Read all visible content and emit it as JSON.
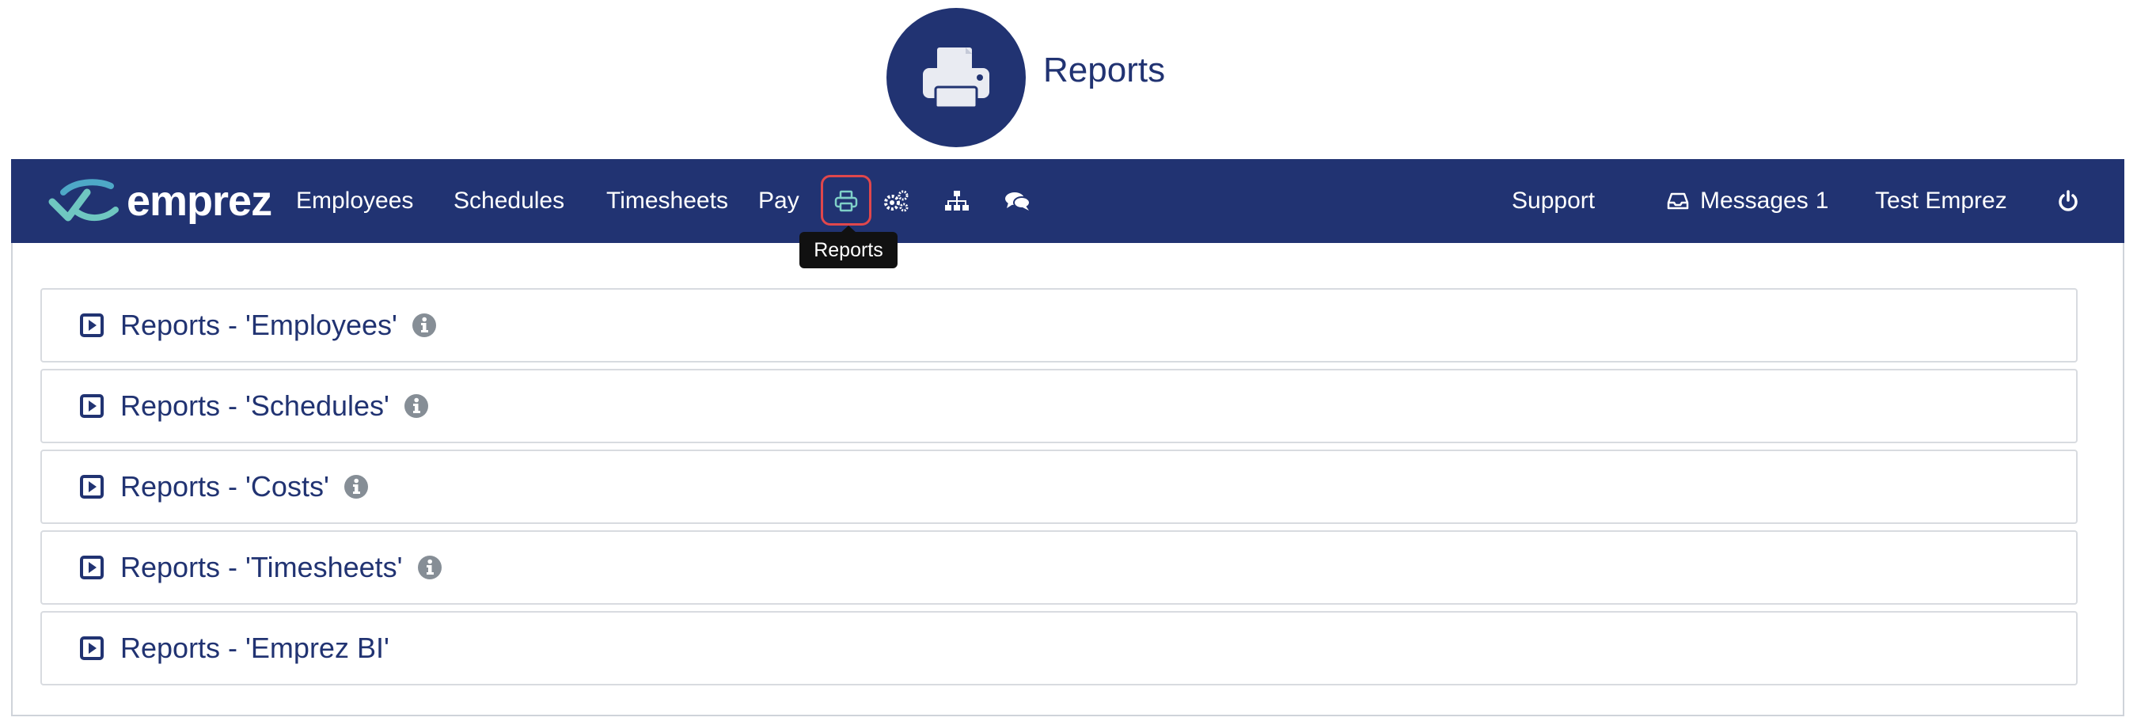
{
  "header": {
    "title": "Reports",
    "icon": "printer-icon"
  },
  "navbar": {
    "logo_text": "emprez",
    "items": [
      {
        "label": "Employees"
      },
      {
        "label": "Schedules"
      },
      {
        "label": "Timesheets"
      },
      {
        "label": "Pay"
      }
    ],
    "icons": [
      "printer-icon",
      "cogs-icon",
      "sitemap-icon",
      "chat-icon"
    ],
    "right": {
      "support": "Support",
      "messages_label": "Messages",
      "messages_count": "1",
      "user": "Test Emprez",
      "power": "power-icon"
    },
    "tooltip": "Reports"
  },
  "panels": [
    {
      "title": "Reports - 'Employees'",
      "has_info": true
    },
    {
      "title": "Reports - 'Schedules'",
      "has_info": true
    },
    {
      "title": "Reports - 'Costs'",
      "has_info": true
    },
    {
      "title": "Reports - 'Timesheets'",
      "has_info": true
    },
    {
      "title": "Reports - 'Emprez BI'",
      "has_info": false
    }
  ],
  "colors": {
    "navy": "#213372",
    "highlight": "#e0474c",
    "info_gray": "#868e96",
    "accent_teal": "#7fd0c8"
  }
}
